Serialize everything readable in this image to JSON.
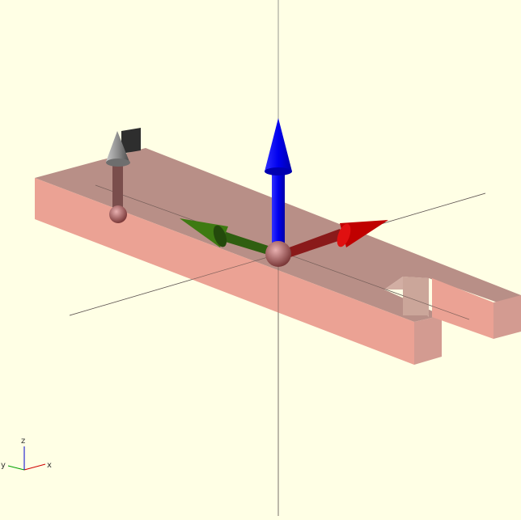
{
  "viewport": {
    "background": "#FFFFE5"
  },
  "scene": {
    "objects": [
      {
        "name": "u-shaped-beam",
        "color": "#E8A094"
      },
      {
        "name": "origin-gizmo",
        "axes": [
          {
            "axis": "x",
            "color": "#C40000"
          },
          {
            "axis": "y",
            "color": "#2E6B00"
          },
          {
            "axis": "z",
            "color": "#0000E0"
          }
        ]
      },
      {
        "name": "secondary-arrow",
        "color": "#8A8A8A"
      }
    ]
  },
  "axis_indicator": {
    "x_label": "x",
    "y_label": "y",
    "z_label": "z",
    "colors": {
      "x": "#D00000",
      "y": "#00A000",
      "z": "#0000D0"
    }
  }
}
